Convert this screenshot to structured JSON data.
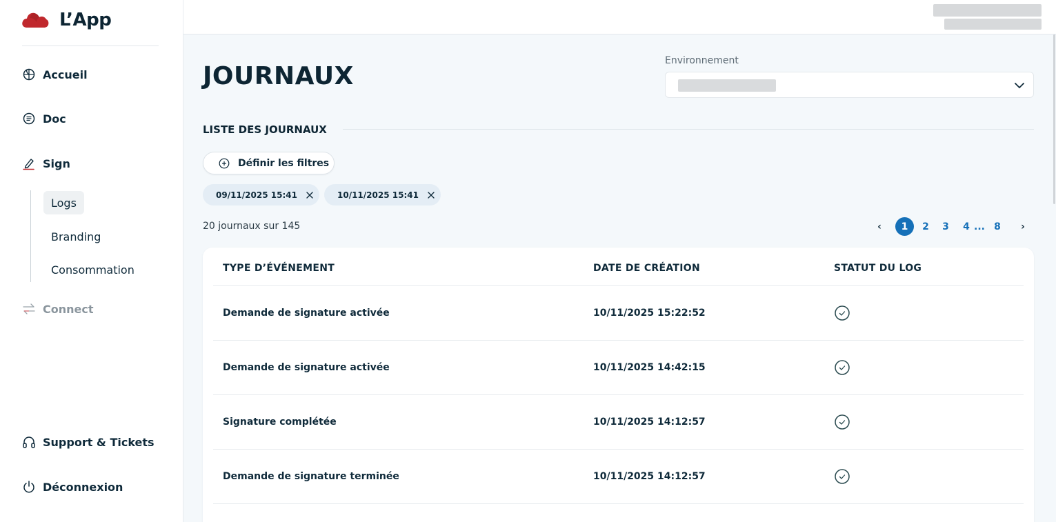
{
  "sidebar": {
    "brand": {
      "name": "L’App",
      "logo_icon": "cloud-logo",
      "logo_color": "#c0282d"
    },
    "nav": [
      {
        "label": "Accueil",
        "icon": "globe-icon"
      },
      {
        "label": "Doc",
        "icon": "document-icon"
      },
      {
        "label": "Sign",
        "icon": "pen-icon"
      }
    ],
    "sign_sub": [
      {
        "label": "Logs",
        "active": true
      },
      {
        "label": "Branding",
        "active": false
      },
      {
        "label": "Consommation",
        "active": false
      }
    ],
    "connect": {
      "label": "Connect",
      "icon": "swap-arrows-icon",
      "disabled": true
    },
    "support": {
      "label": "Support & Tickets",
      "icon": "headset-icon"
    },
    "logout": {
      "label": "Déconnexion",
      "icon": "power-icon"
    }
  },
  "main": {
    "title": "JOURNAUX",
    "environment": {
      "label": "Environnement"
    },
    "section_title": "LISTE DES JOURNAUX",
    "filter_button": "Définir les filtres",
    "chips": [
      {
        "label": "09/11/2025 15:41"
      },
      {
        "label": "10/11/2025 15:41"
      }
    ],
    "count_text": "20 journaux sur 145",
    "pagination": {
      "current": "1",
      "pages": [
        "2",
        "3",
        "4"
      ],
      "ellipsis": "...",
      "last": "8",
      "prev": "‹",
      "next": "›"
    },
    "table": {
      "headers": [
        "TYPE D’ÉVÉNEMENT",
        "DATE DE CRÉATION",
        "STATUT DU LOG"
      ],
      "rows": [
        {
          "type": "Demande de signature activée",
          "date": "10/11/2025 15:22:52",
          "status_icon": "check-circle-icon"
        },
        {
          "type": "Demande de signature activée",
          "date": "10/11/2025 14:42:15",
          "status_icon": "check-circle-icon"
        },
        {
          "type": "Signature complétée",
          "date": "10/11/2025 14:12:57",
          "status_icon": "check-circle-icon"
        },
        {
          "type": "Demande de signature terminée",
          "date": "10/11/2025 14:12:57",
          "status_icon": "check-circle-icon"
        }
      ]
    }
  },
  "colors": {
    "accent": "#1570b8",
    "brand_red": "#c0282d",
    "text_dark": "#0f2a3a",
    "chip_bg": "#e4edf5",
    "page_bg": "#f4f8fb"
  }
}
